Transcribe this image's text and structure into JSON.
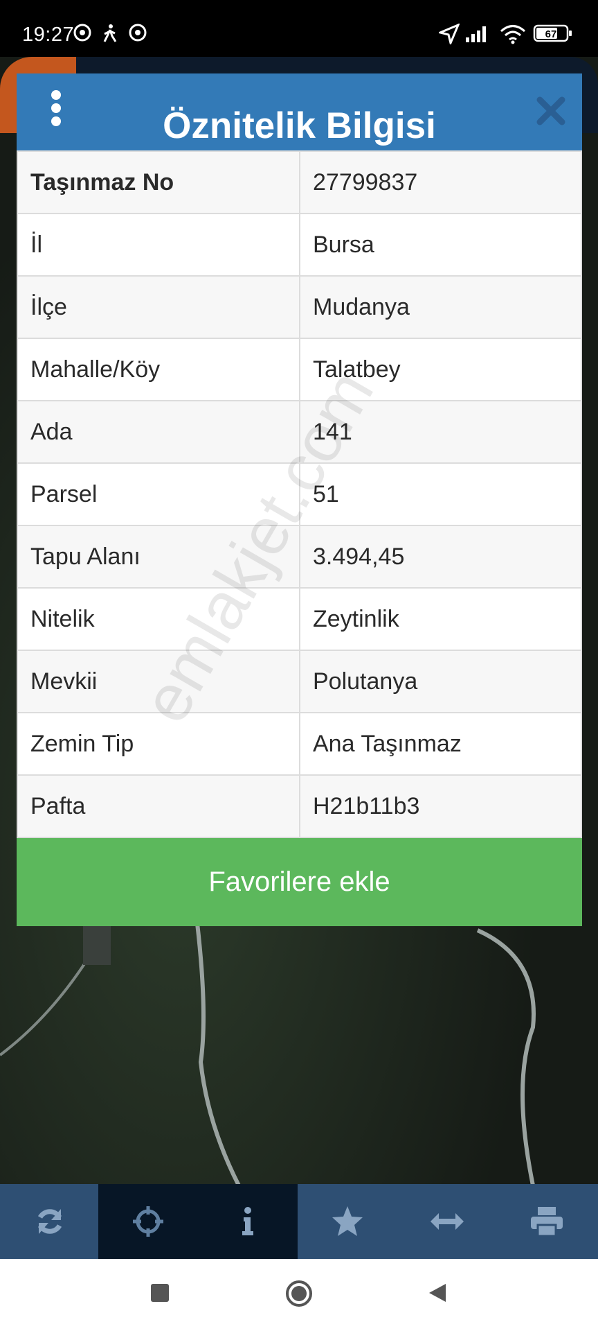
{
  "status_bar": {
    "time": "19:27",
    "battery": "67",
    "left_icons": [
      "chrome-icon",
      "walking-icon",
      "chrome-icon"
    ],
    "right_icons": [
      "location-arrow-icon",
      "signal-icon",
      "wifi-icon",
      "battery-icon"
    ]
  },
  "dialog": {
    "title": "Öznitelik Bilgisi",
    "rows": [
      {
        "key": "Taşınmaz No",
        "value": "27799837"
      },
      {
        "key": "İl",
        "value": "Bursa"
      },
      {
        "key": "İlçe",
        "value": "Mudanya"
      },
      {
        "key": "Mahalle/Köy",
        "value": "Talatbey"
      },
      {
        "key": "Ada",
        "value": "141"
      },
      {
        "key": "Parsel",
        "value": "51"
      },
      {
        "key": "Tapu Alanı",
        "value": "3.494,45"
      },
      {
        "key": "Nitelik",
        "value": "Zeytinlik"
      },
      {
        "key": "Mevkii",
        "value": "Polutanya"
      },
      {
        "key": "Zemin Tip",
        "value": "Ana Taşınmaz"
      },
      {
        "key": "Pafta",
        "value": "H21b11b3"
      }
    ],
    "favorite_button": "Favorilere ekle"
  },
  "watermark": "emlakjet.com",
  "toolbar": {
    "items": [
      "refresh-icon",
      "crosshair-icon",
      "info-icon",
      "star-icon",
      "measure-icon",
      "print-icon"
    ],
    "active": [
      1,
      2
    ]
  },
  "colors": {
    "header": "#337ab7",
    "favorite_button": "#5cb85c",
    "toolbar": "#2e4f73",
    "toolbar_active": "#071626"
  }
}
